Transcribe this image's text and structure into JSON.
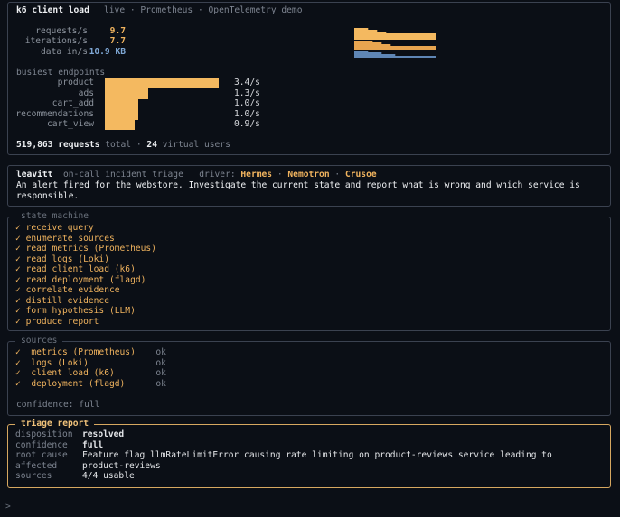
{
  "k6": {
    "title": "k6 client load",
    "subtitle": "live · Prometheus · OpenTelemetry demo",
    "metrics": [
      {
        "label": "requests/s",
        "value": "9.7"
      },
      {
        "label": "iterations/s",
        "value": "7.7"
      },
      {
        "label": "data in/s",
        "value": "10.9 KB"
      }
    ],
    "busiest_label": "busiest endpoints",
    "endpoints": [
      {
        "name": "product",
        "rate": "3.4/s",
        "value": 3.4
      },
      {
        "name": "ads",
        "rate": "1.3/s",
        "value": 1.3
      },
      {
        "name": "cart_add",
        "rate": "1.0/s",
        "value": 1.0
      },
      {
        "name": "recommendations",
        "rate": "1.0/s",
        "value": 1.0
      },
      {
        "name": "cart_view",
        "rate": "0.9/s",
        "value": 0.9
      }
    ],
    "total_requests": "519,863 requests",
    "total_suffix": "total ·",
    "virtual_users": "24",
    "virtual_users_suffix": "virtual users",
    "colors": {
      "requests": "#f4b960",
      "iterations": "#e8a550",
      "data": "#5f86b5"
    }
  },
  "agent": {
    "name": "leavitt",
    "role": "on-call incident triage",
    "driver_label": "driver:",
    "drivers": [
      "Hermes",
      "Nemotron",
      "Crusoe"
    ],
    "sep": "·",
    "message": "An alert fired for the webstore. Investigate the current state and report what is wrong and which service is\nresponsible."
  },
  "state_machine": {
    "title": "state machine",
    "steps": [
      "receive query",
      "enumerate sources",
      "read metrics (Prometheus)",
      "read logs (Loki)",
      "read client load (k6)",
      "read deployment (flagd)",
      "correlate evidence",
      "distill evidence",
      "form hypothesis (LLM)",
      "produce report"
    ]
  },
  "sources": {
    "title": "sources",
    "items": [
      {
        "name": "metrics (Prometheus)",
        "status": "ok"
      },
      {
        "name": "logs (Loki)",
        "status": "ok"
      },
      {
        "name": "client load (k6)",
        "status": "ok"
      },
      {
        "name": "deployment (flagd)",
        "status": "ok"
      }
    ],
    "confidence": "confidence: full"
  },
  "report": {
    "title": "triage report",
    "rows": [
      {
        "key": "disposition",
        "value": "resolved"
      },
      {
        "key": "confidence",
        "value": "full"
      },
      {
        "key": "root cause",
        "value": "Feature flag llmRateLimitError causing rate limiting on product-reviews service leading to"
      },
      {
        "key": "affected",
        "value": "product-reviews"
      },
      {
        "key": "sources",
        "value": "4/4 usable"
      }
    ]
  },
  "prompt": ">"
}
